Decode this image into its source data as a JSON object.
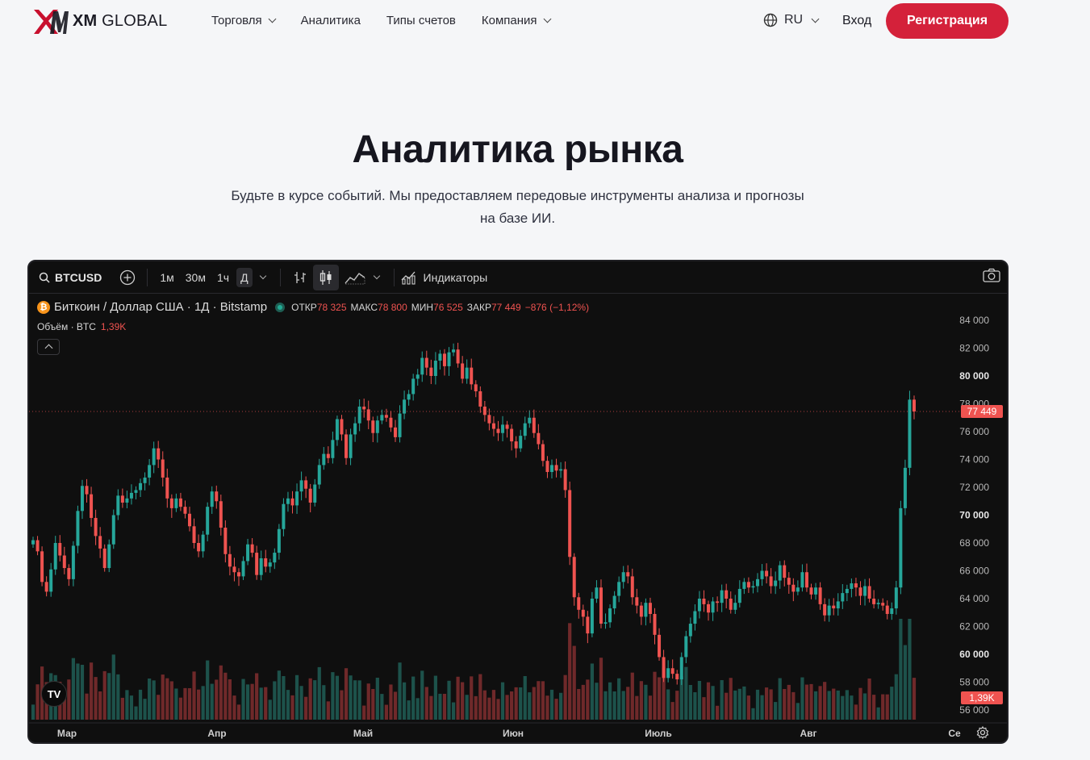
{
  "header": {
    "logo_bold": "XM",
    "logo_light": "GLOBAL",
    "nav": [
      {
        "label": "Торговля",
        "dropdown": true
      },
      {
        "label": "Аналитика",
        "dropdown": false
      },
      {
        "label": "Типы счетов",
        "dropdown": false
      },
      {
        "label": "Компания",
        "dropdown": true
      }
    ],
    "language": "RU",
    "login": "Вход",
    "register": "Регистрация"
  },
  "hero": {
    "title": "Аналитика рынка",
    "subtitle_line1": "Будьте в курсе событий. Мы предоставляем передовые инструменты анализа и прогнозы",
    "subtitle_line2": "на базе ИИ."
  },
  "toolbar": {
    "symbol": "BTCUSD",
    "intervals": [
      "1м",
      "30м",
      "1ч",
      "Д"
    ],
    "active_interval": "Д",
    "indicators": "Индикаторы"
  },
  "legend": {
    "title": "Биткоин / Доллар США · 1Д · Bitstamp",
    "open_label": "ОТКР",
    "open": "78 325",
    "high_label": "МАКС",
    "high": "78 800",
    "low_label": "МИН",
    "low": "76 525",
    "close_label": "ЗАКР",
    "close": "77 449",
    "change": "−876 (−1,12%)",
    "volume_label": "Объём · BTC",
    "volume": "1,39K"
  },
  "colors": {
    "brand": "#d4213a",
    "up": "#26a69a",
    "down": "#ef5350",
    "chart_bg": "#0f0f0f"
  },
  "chart_data": {
    "type": "candlestick",
    "y_ticks": [
      "84 000",
      "82 000",
      "80 000",
      "78 000",
      "76 000",
      "74 000",
      "72 000",
      "70 000",
      "68 000",
      "66 000",
      "64 000",
      "62 000",
      "60 000",
      "58 000",
      "56 000"
    ],
    "y_ticks_bold": [
      "80 000",
      "70 000",
      "60 000"
    ],
    "ylim": [
      55500,
      85000
    ],
    "x_labels": [
      "Мар",
      "Апр",
      "Май",
      "Июн",
      "Июль",
      "Авг",
      "Се"
    ],
    "last_price_label": "77 449",
    "last_volume_label": "1,39K",
    "close_series": [
      68200,
      67400,
      65200,
      64500,
      66100,
      68000,
      67100,
      66200,
      65400,
      67800,
      70300,
      72100,
      71500,
      69800,
      68500,
      67600,
      66200,
      67900,
      70000,
      71400,
      70900,
      71200,
      71600,
      71800,
      72300,
      72700,
      73600,
      74800,
      74000,
      72700,
      71200,
      70500,
      71200,
      70600,
      70100,
      69200,
      68000,
      67400,
      68600,
      70600,
      71700,
      71000,
      69100,
      67200,
      66300,
      65900,
      65600,
      66700,
      67900,
      67300,
      65700,
      66900,
      66300,
      66600,
      67300,
      69000,
      70800,
      71200,
      70700,
      71700,
      72500,
      71900,
      70900,
      72200,
      73600,
      74400,
      74100,
      75400,
      76900,
      75800,
      74100,
      75800,
      76600,
      77800,
      77600,
      76800,
      75900,
      76800,
      77200,
      77000,
      76300,
      75600,
      77300,
      78300,
      78700,
      79800,
      80100,
      81300,
      80600,
      80000,
      81100,
      81600,
      80700,
      81700,
      81900,
      80900,
      79800,
      80600,
      79400,
      78900,
      77800,
      77200,
      76600,
      76200,
      75900,
      76500,
      76200,
      75300,
      74800,
      75700,
      76600,
      77000,
      75900,
      75100,
      73900,
      73100,
      73600,
      73200,
      73300,
      71800,
      67000,
      64100,
      63200,
      62700,
      61500,
      64000,
      64800,
      62200,
      62300,
      63300,
      64200,
      65200,
      65900,
      65600,
      64100,
      63500,
      62700,
      63700,
      62900,
      61400,
      59800,
      58300,
      59000,
      58600,
      58200,
      59800,
      61300,
      62200,
      63100,
      64000,
      63600,
      63000,
      63800,
      63700,
      64600,
      64000,
      63200,
      63700,
      64700,
      65200,
      64800,
      64900,
      65400,
      66000,
      65600,
      64900,
      65300,
      66400,
      65500,
      65000,
      64500,
      64800,
      65900,
      64800,
      64300,
      64800,
      63600,
      62800,
      63500,
      63300,
      63800,
      64400,
      64700,
      65100,
      64800,
      64200,
      64900,
      64000,
      63600,
      63700,
      63500,
      62900,
      63300,
      64800,
      70500,
      73400,
      78300,
      77449
    ],
    "volume_note": "volume histogram under price, colored by candle direction"
  }
}
